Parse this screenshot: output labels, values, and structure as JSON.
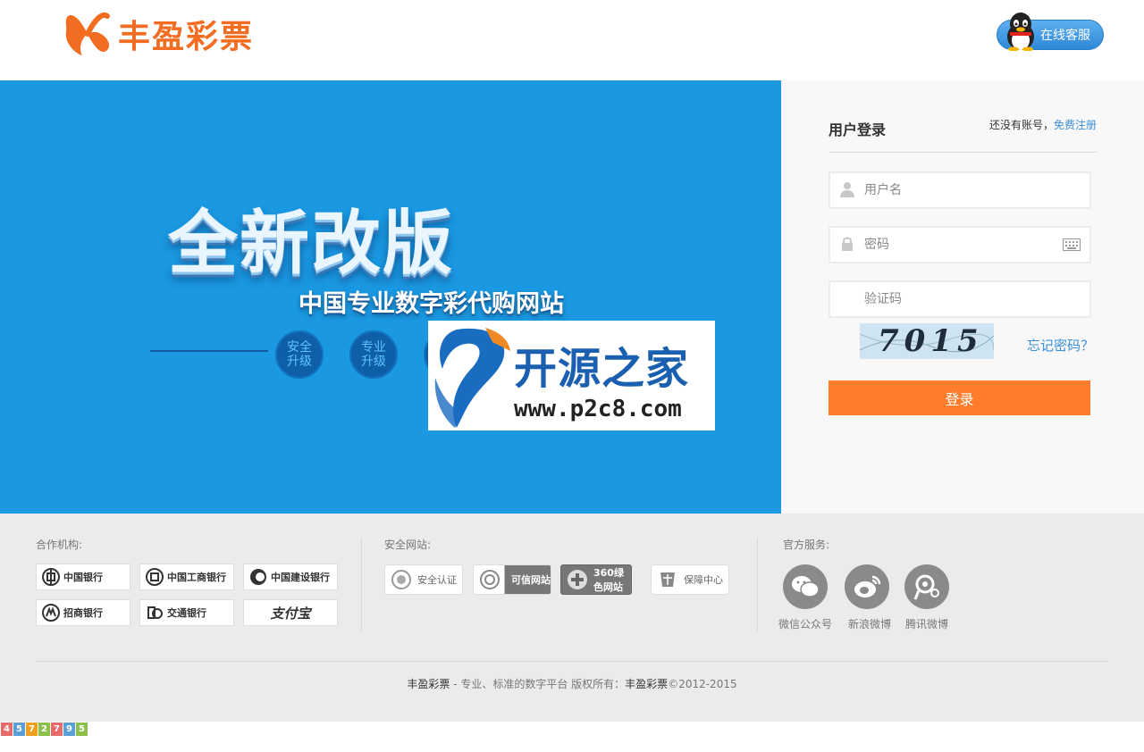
{
  "header": {
    "logo_text": "丰盈彩票",
    "service_label": "在线客服"
  },
  "banner": {
    "headline": "全新改版",
    "subline": "中国专业数字彩代购网站",
    "features": [
      "安全\n升级",
      "专业\n升级"
    ],
    "watermark_text": "开源之家",
    "watermark_url": "www.p2c8.com"
  },
  "login": {
    "title": "用户登录",
    "no_account": "还没有账号，",
    "register_link": "免费注册",
    "username_placeholder": "用户名",
    "password_placeholder": "密码",
    "captcha_placeholder": "验证码",
    "captcha_value": "7015",
    "forgot_password": "忘记密码？",
    "submit_label": "登录"
  },
  "footer": {
    "partners_title": "合作机构:",
    "banks": [
      "中国银行",
      "中国工商银行",
      "中国建设银行",
      "招商银行",
      "交通银行",
      "支付宝"
    ],
    "security_title": "安全网站:",
    "security_badges": [
      "安全认证",
      "可信网站",
      "360绿色网站",
      "保障中心"
    ],
    "service_title": "官方服务:",
    "social": [
      "微信公众号",
      "新浪微博",
      "腾讯微博"
    ],
    "copyright_brand": "丰盈彩票",
    "copyright_mid": " - 专业、标准的数字平台  版权所有：",
    "copyright_owner": "丰盈彩票",
    "copyright_year": "©2012-2015"
  },
  "counter": {
    "digits": [
      "4",
      "5",
      "7",
      "2",
      "7",
      "9",
      "5"
    ],
    "colors": [
      "#e86b6b",
      "#5aa0d8",
      "#f0a020",
      "#8cc04a",
      "#e86b6b",
      "#5aa0d8",
      "#8cc04a"
    ]
  }
}
